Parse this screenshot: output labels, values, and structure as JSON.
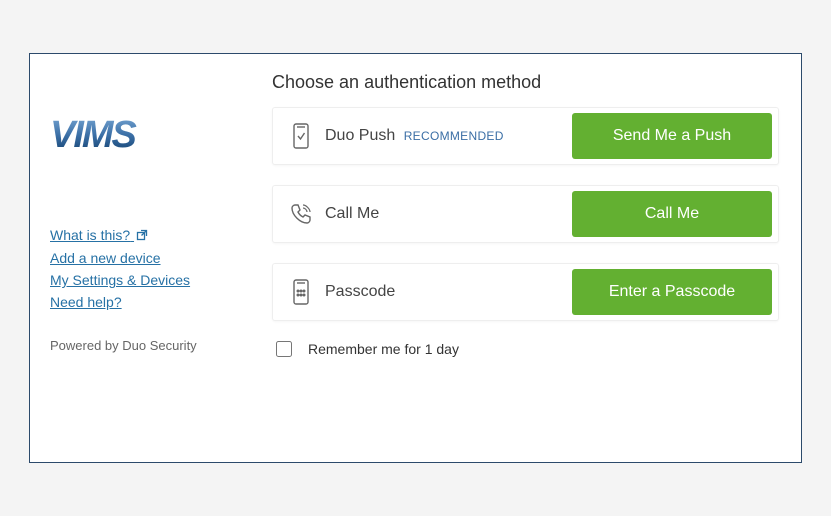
{
  "logo_text": "VIMS",
  "sidebar_links": {
    "what_is_this": "What is this?",
    "add_device": "Add a new device",
    "settings_devices": "My Settings & Devices",
    "need_help": "Need help?"
  },
  "powered_by": "Powered by Duo Security",
  "heading": "Choose an authentication method",
  "methods": {
    "push": {
      "label": "Duo Push",
      "badge": "RECOMMENDED",
      "button": "Send Me a Push"
    },
    "call": {
      "label": "Call Me",
      "button": "Call Me"
    },
    "passcode": {
      "label": "Passcode",
      "button": "Enter a Passcode"
    }
  },
  "remember_label": "Remember me for 1 day",
  "colors": {
    "accent_green": "#63b031",
    "link_blue": "#2671a5",
    "border": "#2c4a6b"
  }
}
